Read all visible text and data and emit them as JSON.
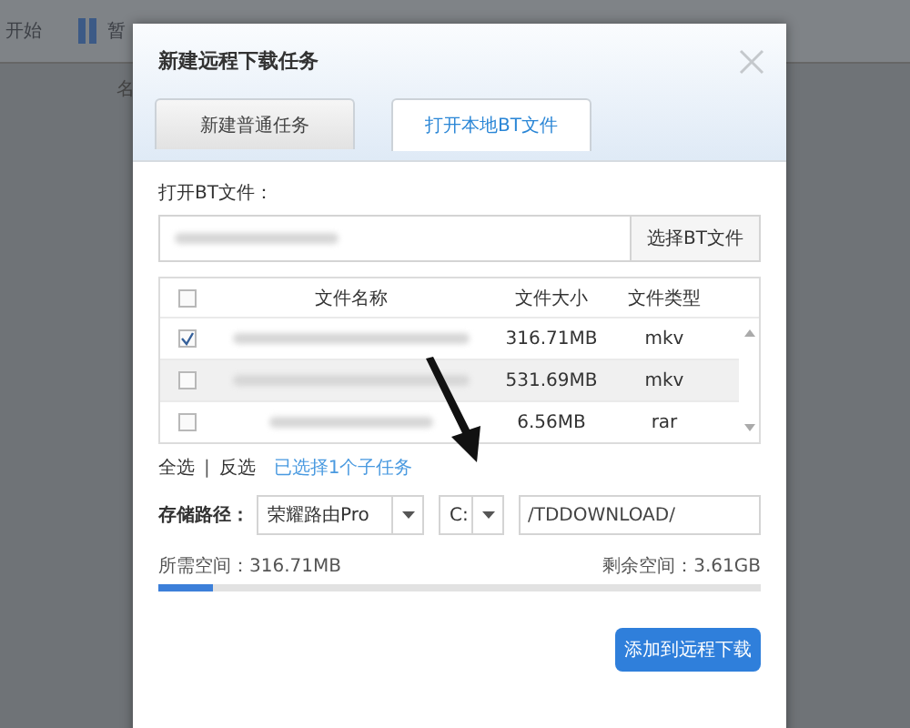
{
  "app_toolbar": {
    "items": [
      "开始",
      "暂"
    ],
    "column_header": "名"
  },
  "dialog": {
    "title": "新建远程下载任务",
    "tabs": [
      {
        "label": "新建普通任务",
        "selected": false
      },
      {
        "label": "打开本地BT文件",
        "selected": true
      }
    ],
    "bt_file_label": "打开BT文件：",
    "choose_button": "选择BT文件",
    "table": {
      "columns": [
        "文件名称",
        "文件大小",
        "文件类型"
      ],
      "all_checked": false,
      "rows": [
        {
          "checked": true,
          "hovered": false,
          "size": "316.71MB",
          "type": "mkv"
        },
        {
          "checked": false,
          "hovered": true,
          "size": "531.69MB",
          "type": "mkv"
        },
        {
          "checked": false,
          "hovered": false,
          "size": "6.56MB",
          "type": "rar"
        }
      ]
    },
    "select_all": "全选",
    "separator": "|",
    "invert": "反选",
    "selected_info": "已选择1个子任务",
    "storage_label": "存储路径：",
    "device": "荣耀路由Pro",
    "drive": "C:",
    "path": "/TDDOWNLOAD/",
    "required_space": "所需空间：316.71MB",
    "free_space": "剩余空间：3.61GB",
    "space": {
      "level": 0.09
    },
    "submit_button": "添加到远程下载"
  }
}
